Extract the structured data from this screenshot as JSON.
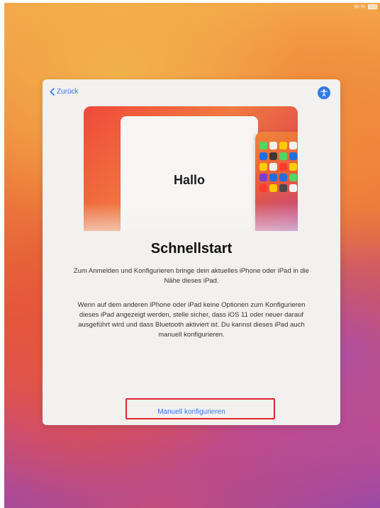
{
  "status_bar": {
    "battery_text": "90 %"
  },
  "nav": {
    "back_label": "Zurück",
    "accessibility_icon": "accessibility-icon"
  },
  "hero": {
    "greeting": "Hallo"
  },
  "content": {
    "title": "Schnellstart",
    "paragraph1": "Zum Anmelden und Konfigurieren bringe dein aktuelles iPhone oder iPad in die Nähe dieses iPad.",
    "paragraph2": "Wenn auf dem anderen iPhone oder iPad keine Optionen zum Konfigurieren dieses iPad angezeigt werden, stelle sicher, dass iOS 11 oder neuer darauf ausgeführt wird und dass Bluetooth aktiviert ist. Du kannst dieses iPad auch manuell konfigurieren."
  },
  "actions": {
    "manual_label": "Manuell konfigurieren"
  },
  "colors": {
    "accent": "#2f78e6",
    "highlight": "#e0262b",
    "app_icons": [
      "#4cd964",
      "#f2f2f2",
      "#ffcc00",
      "#f2f2f2",
      "#1e6fe0",
      "#3a3a3c",
      "#4cd964",
      "#1e6fe0",
      "#ffcc00",
      "#f2f2f2",
      "#ff3b30",
      "#ffcc00",
      "#7a3cd6",
      "#1e6fe0",
      "#1e6fe0",
      "#4cd964",
      "#ff3b30",
      "#ffcc00",
      "#4a4a4a",
      "#f2f2f2"
    ]
  }
}
